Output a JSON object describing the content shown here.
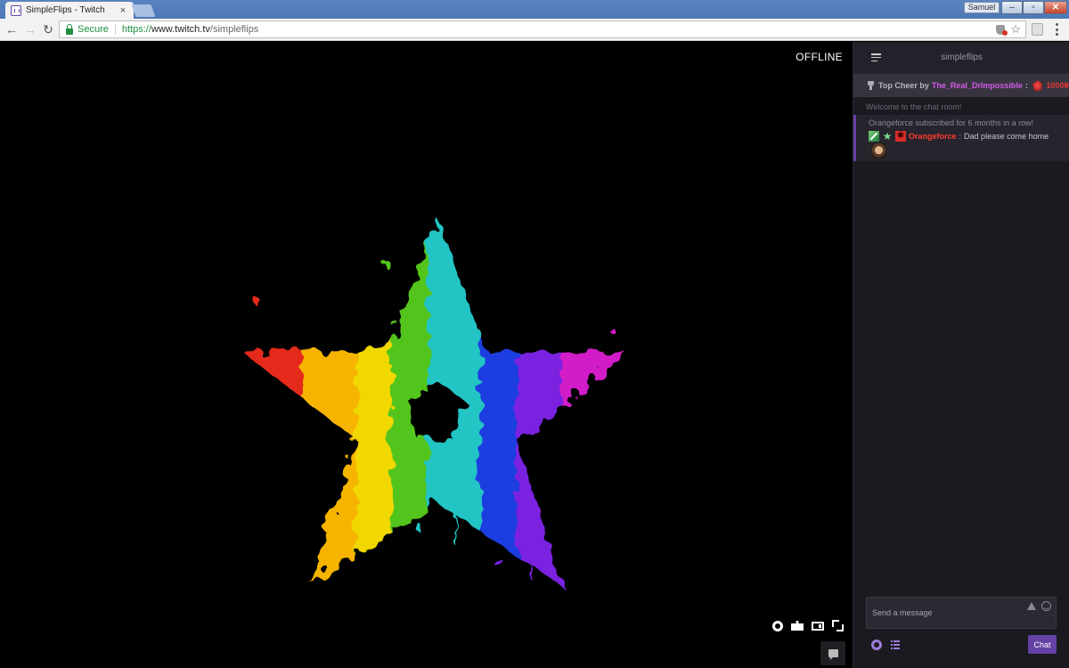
{
  "browser": {
    "tab_title": "SimpleFlips - Twitch",
    "tab_close": "×",
    "user_badge": "Samuel",
    "window_min": "–",
    "window_max": "▫",
    "window_close": "✕",
    "back_glyph": "←",
    "forward_glyph": "→",
    "reload_glyph": "↻",
    "secure_label": "Secure",
    "url_scheme": "https://",
    "url_host": "www.twitch.tv",
    "url_path": "/simpleflips",
    "star_glyph": "☆"
  },
  "player": {
    "status": "OFFLINE",
    "colors": [
      "#e52a1c",
      "#f6b400",
      "#f0d800",
      "#52c41a",
      "#22c4c4",
      "#1a3ee0",
      "#7a22e0",
      "#d21ec8"
    ],
    "icons": [
      "gear-icon",
      "clapper-icon",
      "theater-icon",
      "fullscreen-icon",
      "chat-bubble-icon"
    ]
  },
  "chat": {
    "channel": "simpleflips",
    "top_cheer": {
      "label": "Top Cheer by",
      "user": "The_Real_DrImpossible",
      "colon": ":",
      "amount": "10000",
      "chevron": "▾"
    },
    "welcome": "Welcome to the chat room!",
    "subscription": {
      "notice": "Orangeforce subscribed for 6 months in a row!",
      "star_badge": "★",
      "sub_badge": "✱",
      "user": "Orangeforce",
      "colon": ":",
      "message": "Dad please come home"
    },
    "composer_placeholder": "Send a message",
    "send_label": "Chat",
    "accent": "#6441a4"
  }
}
